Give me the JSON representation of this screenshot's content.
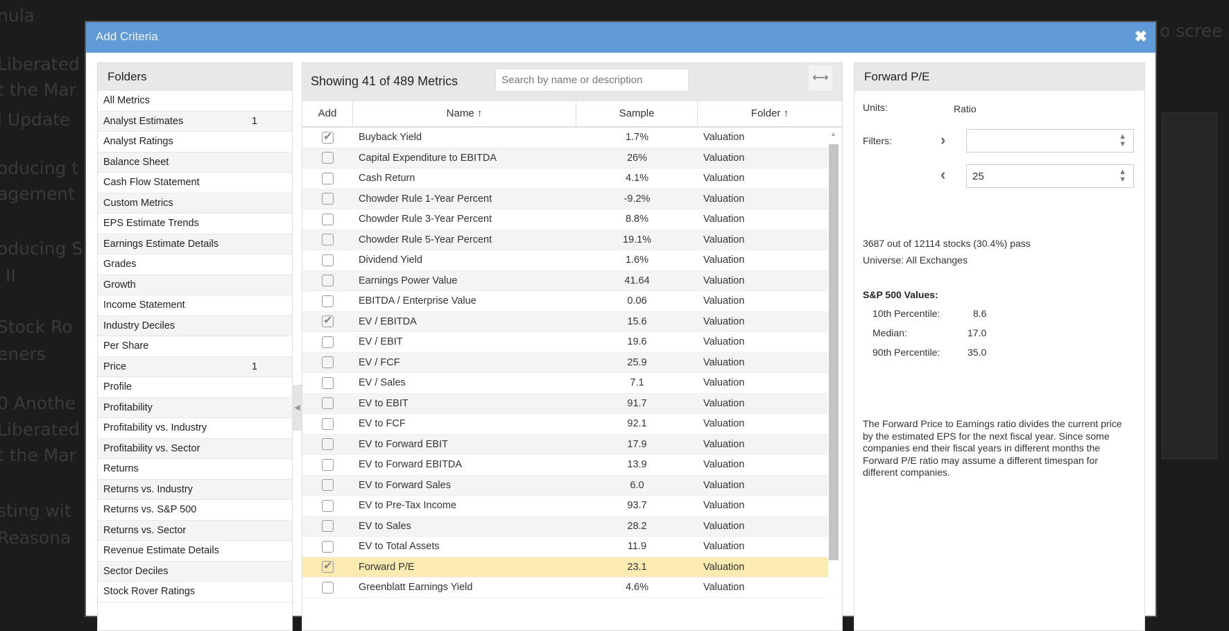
{
  "background": {
    "fragments": [
      "nula",
      "Liberated",
      "t the Mar",
      "l Update",
      "oducing t",
      "agement",
      "oducing S",
      "II",
      "Stock Ro",
      "eners",
      "0 Anothe",
      "Liberated",
      "t the Mar",
      "sting wit",
      "Reasona"
    ],
    "right_fragment": "o scree"
  },
  "dialog": {
    "title": "Add Criteria",
    "close_icon": "close-icon"
  },
  "folders": {
    "title": "Folders",
    "items": [
      {
        "label": "All Metrics",
        "count": ""
      },
      {
        "label": "Analyst Estimates",
        "count": "1"
      },
      {
        "label": "Analyst Ratings",
        "count": ""
      },
      {
        "label": "Balance Sheet",
        "count": ""
      },
      {
        "label": "Cash Flow Statement",
        "count": ""
      },
      {
        "label": "Custom Metrics",
        "count": ""
      },
      {
        "label": "EPS Estimate Trends",
        "count": ""
      },
      {
        "label": "Earnings Estimate Details",
        "count": ""
      },
      {
        "label": "Grades",
        "count": ""
      },
      {
        "label": "Growth",
        "count": ""
      },
      {
        "label": "Income Statement",
        "count": ""
      },
      {
        "label": "Industry Deciles",
        "count": ""
      },
      {
        "label": "Per Share",
        "count": ""
      },
      {
        "label": "Price",
        "count": "1"
      },
      {
        "label": "Profile",
        "count": ""
      },
      {
        "label": "Profitability",
        "count": ""
      },
      {
        "label": "Profitability vs. Industry",
        "count": ""
      },
      {
        "label": "Profitability vs. Sector",
        "count": ""
      },
      {
        "label": "Returns",
        "count": ""
      },
      {
        "label": "Returns vs. Industry",
        "count": ""
      },
      {
        "label": "Returns vs. S&P 500",
        "count": ""
      },
      {
        "label": "Returns vs. Sector",
        "count": ""
      },
      {
        "label": "Revenue Estimate Details",
        "count": ""
      },
      {
        "label": "Sector Deciles",
        "count": ""
      },
      {
        "label": "Stock Rover Ratings",
        "count": ""
      }
    ]
  },
  "metrics": {
    "showing": "Showing 41 of 489 Metrics",
    "search_placeholder": "Search by name or description",
    "search_value": "",
    "columns": {
      "add": "Add",
      "name": "Name ↑",
      "sample": "Sample",
      "folder": "Folder ↑"
    },
    "rows": [
      {
        "checked": true,
        "name": "Buyback Yield",
        "sample": "1.7%",
        "folder": "Valuation"
      },
      {
        "checked": false,
        "name": "Capital Expenditure to EBITDA",
        "sample": "26%",
        "folder": "Valuation"
      },
      {
        "checked": false,
        "name": "Cash Return",
        "sample": "4.1%",
        "folder": "Valuation"
      },
      {
        "checked": false,
        "name": "Chowder Rule 1-Year Percent",
        "sample": "-9.2%",
        "folder": "Valuation"
      },
      {
        "checked": false,
        "name": "Chowder Rule 3-Year Percent",
        "sample": "8.8%",
        "folder": "Valuation"
      },
      {
        "checked": false,
        "name": "Chowder Rule 5-Year Percent",
        "sample": "19.1%",
        "folder": "Valuation"
      },
      {
        "checked": false,
        "name": "Dividend Yield",
        "sample": "1.6%",
        "folder": "Valuation"
      },
      {
        "checked": false,
        "name": "Earnings Power Value",
        "sample": "41.64",
        "folder": "Valuation"
      },
      {
        "checked": false,
        "name": "EBITDA / Enterprise Value",
        "sample": "0.06",
        "folder": "Valuation"
      },
      {
        "checked": true,
        "name": "EV / EBITDA",
        "sample": "15.6",
        "folder": "Valuation"
      },
      {
        "checked": false,
        "name": "EV / EBIT",
        "sample": "19.6",
        "folder": "Valuation"
      },
      {
        "checked": false,
        "name": "EV / FCF",
        "sample": "25.9",
        "folder": "Valuation"
      },
      {
        "checked": false,
        "name": "EV / Sales",
        "sample": "7.1",
        "folder": "Valuation"
      },
      {
        "checked": false,
        "name": "EV to EBIT",
        "sample": "91.7",
        "folder": "Valuation"
      },
      {
        "checked": false,
        "name": "EV to FCF",
        "sample": "92.1",
        "folder": "Valuation"
      },
      {
        "checked": false,
        "name": "EV to Forward EBIT",
        "sample": "17.9",
        "folder": "Valuation"
      },
      {
        "checked": false,
        "name": "EV to Forward EBITDA",
        "sample": "13.9",
        "folder": "Valuation"
      },
      {
        "checked": false,
        "name": "EV to Forward Sales",
        "sample": "6.0",
        "folder": "Valuation"
      },
      {
        "checked": false,
        "name": "EV to Pre-Tax Income",
        "sample": "93.7",
        "folder": "Valuation"
      },
      {
        "checked": false,
        "name": "EV to Sales",
        "sample": "28.2",
        "folder": "Valuation"
      },
      {
        "checked": false,
        "name": "EV to Total Assets",
        "sample": "11.9",
        "folder": "Valuation"
      },
      {
        "checked": true,
        "selected": true,
        "name": "Forward P/E",
        "sample": "23.1",
        "folder": "Valuation"
      },
      {
        "checked": false,
        "name": "Greenblatt Earnings Yield",
        "sample": "4.6%",
        "folder": "Valuation"
      }
    ]
  },
  "detail": {
    "title": "Forward P/E",
    "units_label": "Units:",
    "units_value": "Ratio",
    "filters_label": "Filters:",
    "min_value": "",
    "max_value": "25",
    "pass_text": "3687 out of 12114 stocks (30.4%) pass",
    "universe": "Universe: All Exchanges",
    "sp500_title": "S&P 500 Values:",
    "p10_label": "10th Percentile:",
    "p10": "8.6",
    "median_label": "Median:",
    "median": "17.0",
    "p90_label": "90th Percentile:",
    "p90": "35.0",
    "description": "The Forward Price to Earnings ratio divides the current price by the estimated EPS for the next fiscal year. Since some companies end their fiscal years in different months the Forward P/E ratio may assume a different timespan for different companies."
  },
  "colors": {
    "titlebar": "#609bd8",
    "selected_row": "#fcebb0"
  }
}
